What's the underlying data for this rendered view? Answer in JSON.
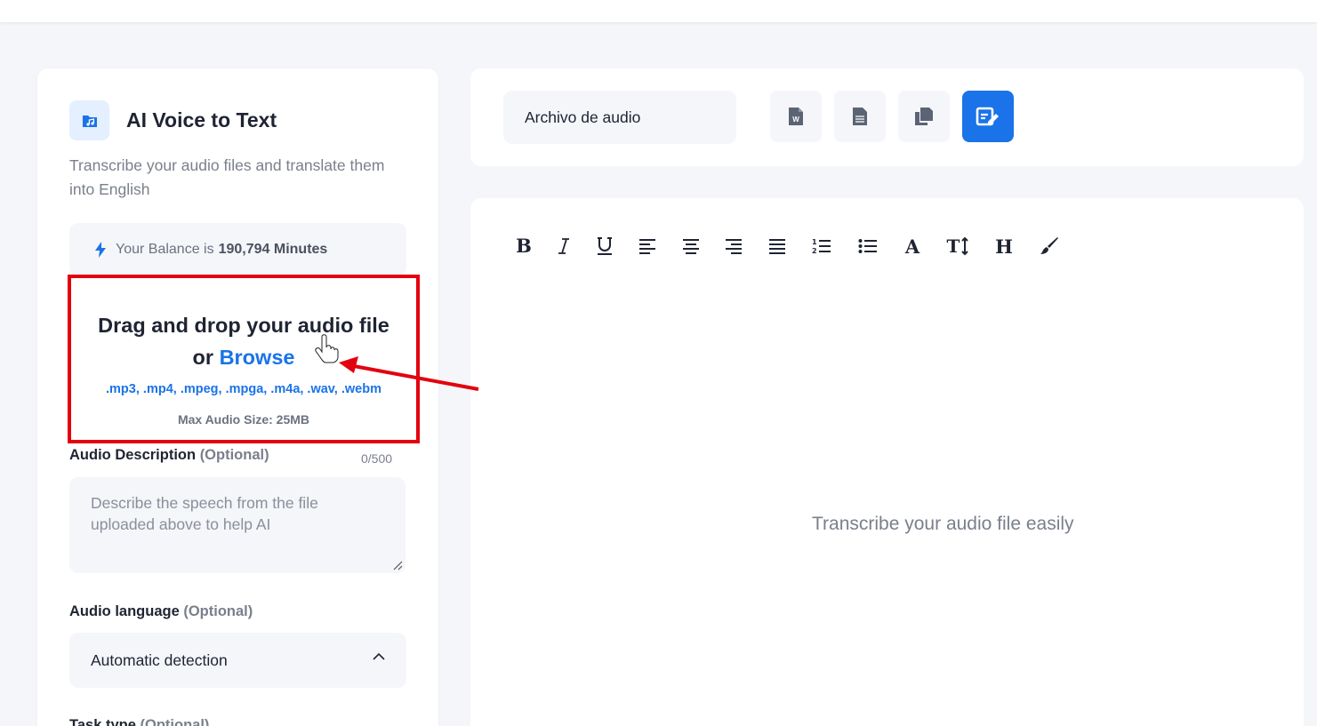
{
  "panel": {
    "title": "AI Voice to Text",
    "subtitle": "Transcribe your audio files and translate them into English",
    "balance_prefix": "Your Balance is",
    "balance_value": "190,794 Minutes"
  },
  "dropzone": {
    "title_part1": "Drag and drop your audio file or",
    "browse": "Browse",
    "formats": ".mp3, .mp4, .mpeg, .mpga, .m4a, .wav, .webm",
    "max_size": "Max Audio Size: 25MB"
  },
  "description": {
    "label": "Audio Description",
    "optional": "(Optional)",
    "counter": "0/500",
    "placeholder": "Describe the speech from the file uploaded above to help AI"
  },
  "language": {
    "label": "Audio language",
    "optional": "(Optional)",
    "selected": "Automatic detection"
  },
  "task": {
    "label": "Task type",
    "optional": "(Optional)"
  },
  "toolbar": {
    "file_name": "Archivo de audio"
  },
  "editor": {
    "placeholder": "Transcribe your audio file easily"
  },
  "colors": {
    "accent": "#1a73e8",
    "highlight": "#e3000f"
  }
}
